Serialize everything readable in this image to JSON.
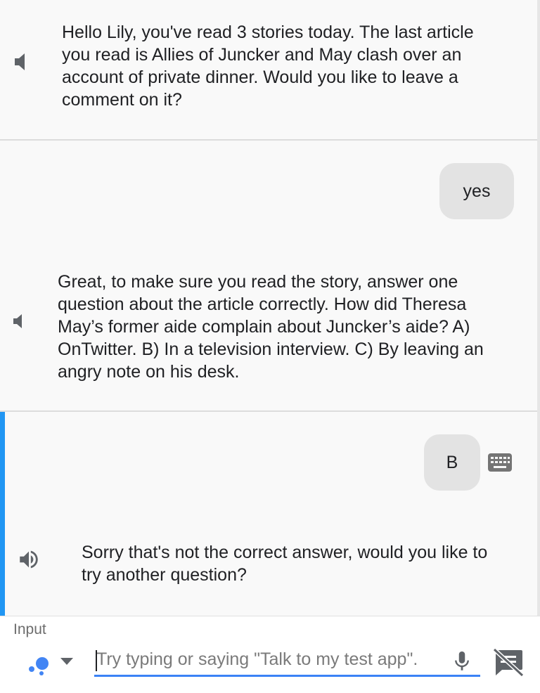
{
  "conversation": {
    "message1": {
      "speaker_icon": "volume-muted-icon",
      "text": "Hello Lily, you've read 3 stories today. The last article you read is Allies of Juncker and May clash over an account of private dinner. Would you like to leave a comment on it?"
    },
    "user_reply1": {
      "text": "yes"
    },
    "message2": {
      "speaker_icon": "volume-muted-icon",
      "text": "Great, to make sure you read the story, answer one question about the article correctly. How did Theresa May’s former aide complain about Juncker’s aide? A) OnTwitter. B) In a television interview. C) By leaving an angry note on his desk."
    },
    "user_reply2": {
      "text": "B",
      "input_method_icon": "keyboard-icon"
    },
    "message3": {
      "speaker_icon": "volume-up-icon",
      "text": "Sorry that's not the correct answer, would you like to try another question?"
    }
  },
  "input": {
    "label": "Input",
    "placeholder": "Try typing or saying \"Talk to my test app\".",
    "value": "",
    "assistant_icon": "assistant-dots-icon",
    "dropdown_icon": "caret-down-icon",
    "mic_icon": "microphone-icon",
    "keyboard_off_icon": "speech-bubble-off-icon"
  },
  "colors": {
    "accent": "#2196f3",
    "underline": "#3b82f6",
    "bubble": "#e3e3e3",
    "background": "#f9f9f9"
  }
}
